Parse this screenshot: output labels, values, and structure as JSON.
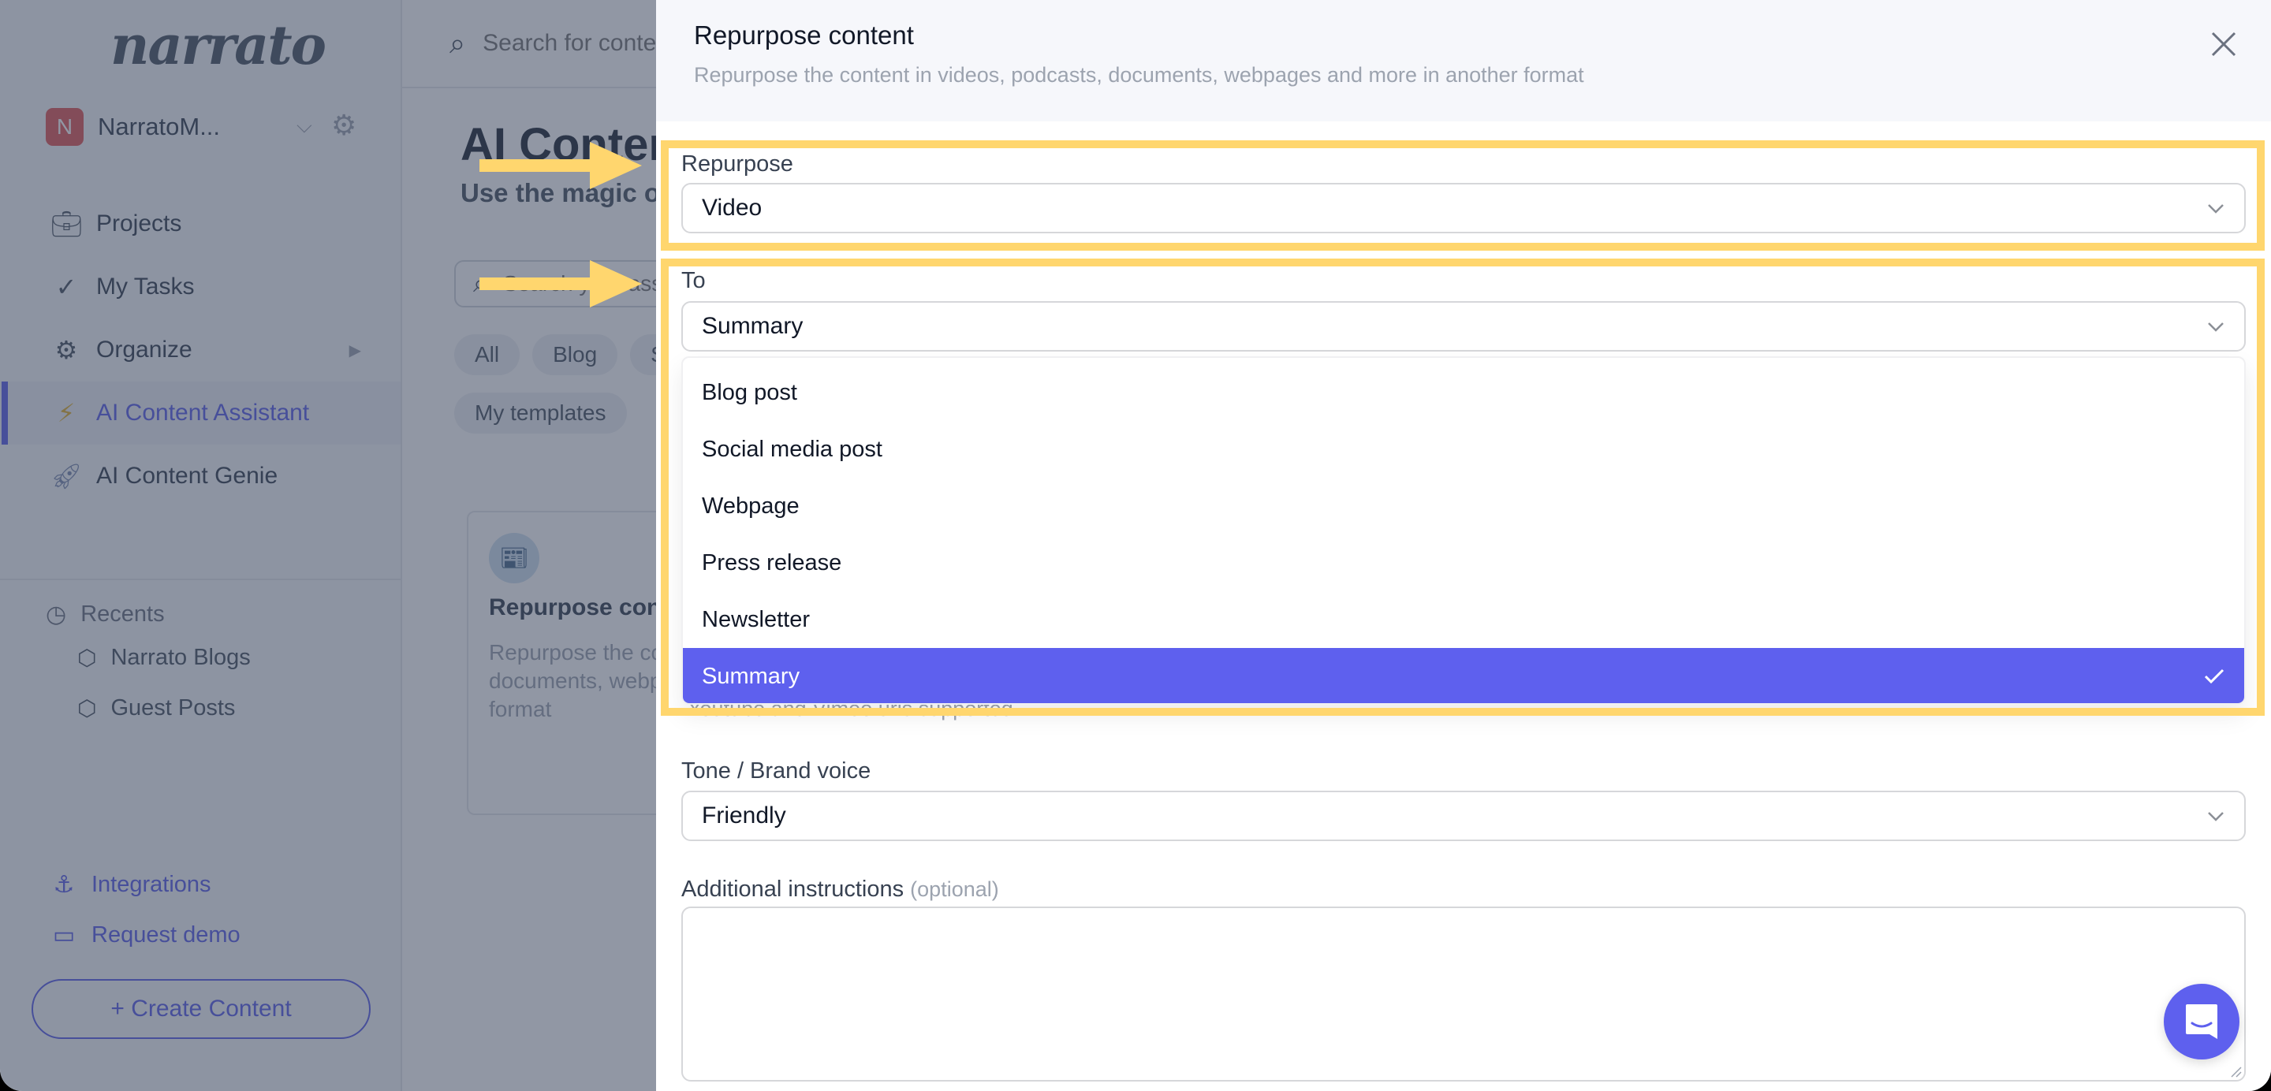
{
  "sidebar": {
    "logo": "narrato",
    "workspace": {
      "initial": "N",
      "name": "NarratoM...",
      "avatar_color": "#e05a5a"
    },
    "nav": [
      {
        "label": "Projects",
        "icon": "briefcase-icon"
      },
      {
        "label": "My Tasks",
        "icon": "double-check-icon"
      },
      {
        "label": "Organize",
        "icon": "gears-icon"
      },
      {
        "label": "AI Content Assistant",
        "icon": "lightning-icon",
        "active": true
      },
      {
        "label": "AI Content Genie",
        "icon": "rocket-icon"
      }
    ],
    "recents": {
      "label": "Recents",
      "items": [
        "Narrato Blogs",
        "Guest Posts"
      ]
    },
    "links": [
      {
        "label": "Integrations",
        "icon": "anchor-icon"
      },
      {
        "label": "Request demo",
        "icon": "monitor-icon"
      }
    ],
    "create_button": "+ Create Content"
  },
  "main": {
    "search_placeholder": "Search for content",
    "title": "AI Content Assistant",
    "subtitle": "Use the magic of AI",
    "template_search_placeholder": "Search your assistants",
    "chips": [
      "All",
      "Blog",
      "Social",
      "My templates"
    ],
    "card": {
      "title": "Repurpose content",
      "description": "Repurpose the content in videos, podcasts, documents, webpages and more in another format"
    }
  },
  "modal": {
    "title": "Repurpose content",
    "subtitle": "Repurpose the content in videos, podcasts, documents, webpages and more in another format",
    "repurpose": {
      "label": "Repurpose",
      "value": "Video"
    },
    "to": {
      "label": "To",
      "value": "Summary",
      "options": [
        "Blog post",
        "Social media post",
        "Webpage",
        "Press release",
        "Newsletter",
        "Summary"
      ],
      "selected_index": 5
    },
    "hint": "Youtube and Vimeo urls supported.",
    "tone": {
      "label": "Tone / Brand voice",
      "value": "Friendly"
    },
    "instructions": {
      "label": "Additional instructions",
      "optional": "(optional)",
      "value": ""
    }
  },
  "colors": {
    "accent": "#5e60ee",
    "highlight_frame": "#ffd66e",
    "overlay": "#37415a"
  }
}
